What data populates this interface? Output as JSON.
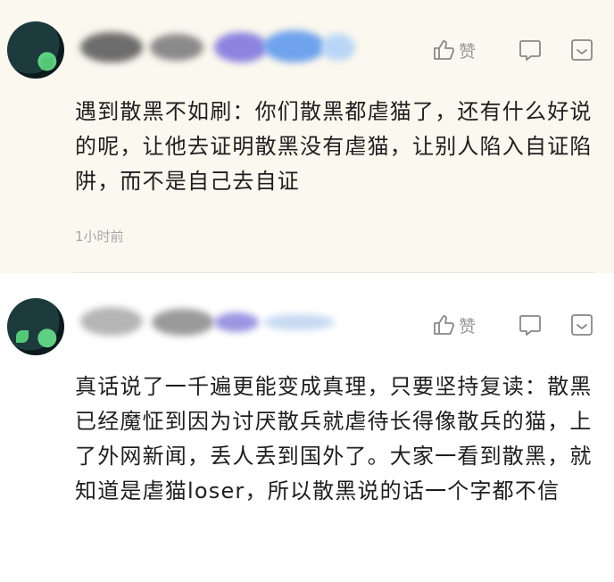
{
  "comments": [
    {
      "like_label": "赞",
      "text": "遇到散黑不如刷：你们散黑都虐猫了，还有什么好说的呢，让他去证明散黑没有虐猫，让别人陷入自证陷阱，而不是自己去自证",
      "time": "1小时前"
    },
    {
      "like_label": "赞",
      "text": "真话说了一千遍更能变成真理，只要坚持复读：散黑已经魔怔到因为讨厌散兵就虐待长得像散兵的猫，上了外网新闻，丢人丢到国外了。大家一看到散黑，就知道是虐猫loser，所以散黑说的话一个字都不信"
    }
  ],
  "icons": {
    "like": "thumbs-up-icon",
    "reply": "reply-bubble-icon",
    "more": "more-options-icon"
  },
  "colors": {
    "first_comment_bg": "#fbf8ef",
    "text": "#1e1e1e",
    "meta": "#a8a8a8",
    "icon": "#888888"
  }
}
